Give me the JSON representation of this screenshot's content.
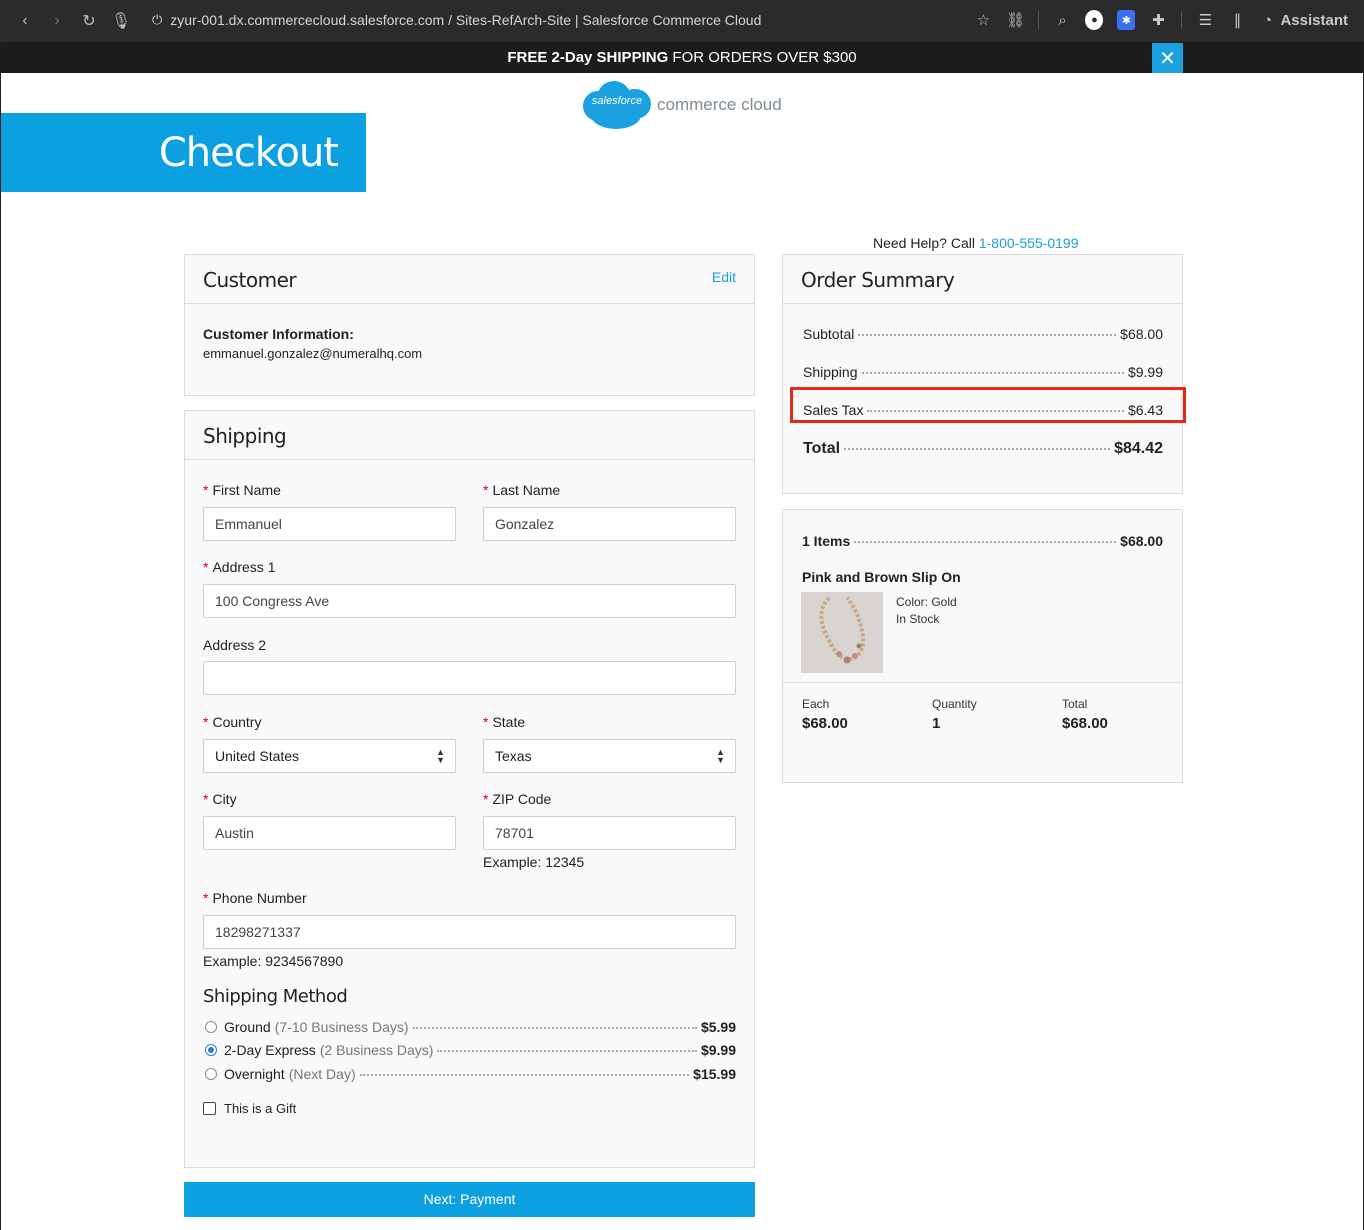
{
  "browser": {
    "url": "zyur-001.dx.commercecloud.salesforce.com / Sites-RefArch-Site | Salesforce Commerce Cloud",
    "assistant_label": "Assistant"
  },
  "banner": {
    "bold_text": "FREE 2-Day SHIPPING",
    "rest_text": " FOR ORDERS OVER $300"
  },
  "logo": {
    "cloud_text": "salesforce",
    "product_text": "commerce cloud"
  },
  "hero": {
    "title": "Checkout"
  },
  "help": {
    "text": "Need Help? Call ",
    "phone": "1-800-555-0199"
  },
  "customer": {
    "title": "Customer",
    "edit_label": "Edit",
    "info_label": "Customer Information:",
    "email": "emmanuel.gonzalez@numeralhq.com"
  },
  "shipping": {
    "title": "Shipping",
    "first_name_label": "First Name",
    "first_name_value": "Emmanuel",
    "last_name_label": "Last Name",
    "last_name_value": "Gonzalez",
    "address1_label": "Address 1",
    "address1_value": "100 Congress Ave",
    "address2_label": "Address 2",
    "address2_value": "",
    "country_label": "Country",
    "country_value": "United States",
    "state_label": "State",
    "state_value": "Texas",
    "city_label": "City",
    "city_value": "Austin",
    "zip_label": "ZIP Code",
    "zip_value": "78701",
    "zip_example": "Example: 12345",
    "phone_label": "Phone Number",
    "phone_value": "18298271337",
    "phone_example": "Example: 9234567890",
    "method_title": "Shipping Method",
    "methods": [
      {
        "name": "Ground",
        "detail": "(7-10 Business Days)",
        "price": "$5.99",
        "selected": false
      },
      {
        "name": "2-Day Express",
        "detail": "(2 Business Days)",
        "price": "$9.99",
        "selected": true
      },
      {
        "name": "Overnight",
        "detail": "(Next Day)",
        "price": "$15.99",
        "selected": false
      }
    ],
    "gift_label": "This is a Gift",
    "next_button": "Next: Payment"
  },
  "order_summary": {
    "title": "Order Summary",
    "subtotal_label": "Subtotal",
    "subtotal_value": "$68.00",
    "shipping_label": "Shipping",
    "shipping_value": "$9.99",
    "tax_label": "Sales Tax",
    "tax_value": "$6.43",
    "total_label": "Total",
    "total_value": "$84.42"
  },
  "items": {
    "count_label": "1 Items",
    "count_value": "$68.00",
    "product_name": "Pink and Brown Slip On",
    "color_attr": "Color: Gold",
    "stock": "In Stock",
    "each_label": "Each",
    "each_value": "$68.00",
    "qty_label": "Quantity",
    "qty_value": "1",
    "total_label": "Total",
    "total_value": "$68.00"
  },
  "colors": {
    "accent": "#0da0e0",
    "highlight": "#e32a14",
    "required": "#d0021b"
  }
}
